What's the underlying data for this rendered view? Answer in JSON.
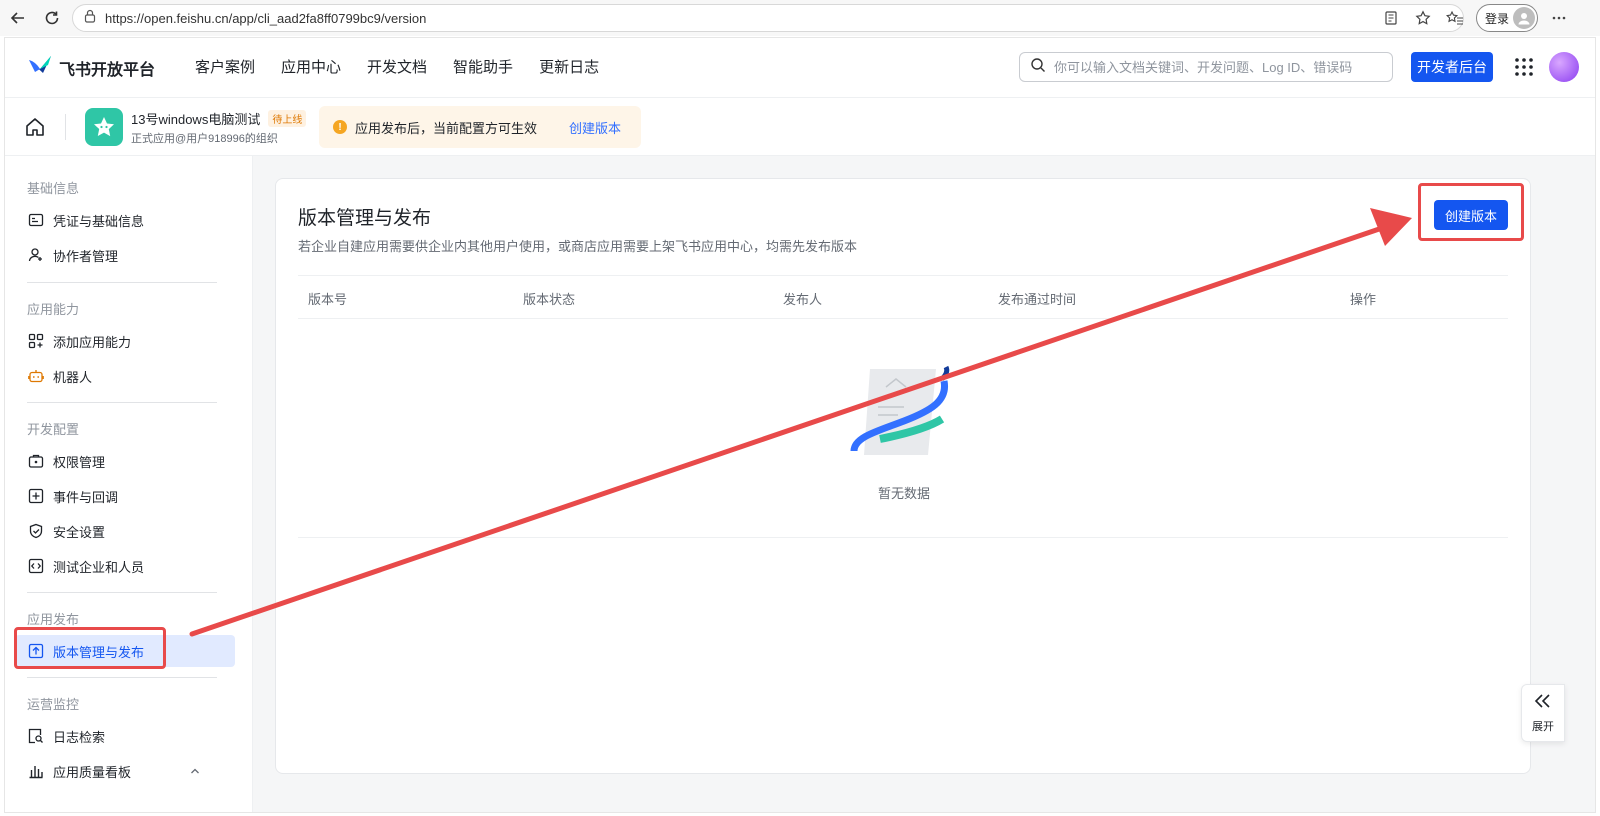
{
  "browser": {
    "url": "https://open.feishu.cn/app/cli_aad2fa8ff0799bc9/version",
    "login_label": "登录"
  },
  "header": {
    "brand": "飞书开放平台",
    "nav": [
      "客户案例",
      "应用中心",
      "开发文档",
      "智能助手",
      "更新日志"
    ],
    "search_placeholder": "你可以输入文档关键词、开发问题、Log ID、错误码",
    "dev_console": "开发者后台"
  },
  "appbar": {
    "app_name": "13号windows电脑测试",
    "status_tag": "待上线",
    "org": "正式应用@用户918996的组织",
    "notice_text": "应用发布后，当前配置方可生效",
    "notice_link": "创建版本"
  },
  "sidebar": {
    "groups": [
      {
        "title": "基础信息",
        "items": [
          "凭证与基础信息",
          "协作者管理"
        ]
      },
      {
        "title": "应用能力",
        "items": [
          "添加应用能力",
          "机器人"
        ]
      },
      {
        "title": "开发配置",
        "items": [
          "权限管理",
          "事件与回调",
          "安全设置",
          "测试企业和人员"
        ]
      },
      {
        "title": "应用发布",
        "items": [
          "版本管理与发布"
        ]
      },
      {
        "title": "运营监控",
        "items": [
          "日志检索",
          "应用质量看板"
        ]
      }
    ]
  },
  "main": {
    "title": "版本管理与发布",
    "description": "若企业自建应用需要供企业内其他用户使用，或商店应用需要上架飞书应用中心，均需先发布版本",
    "create_button": "创建版本",
    "columns": [
      "版本号",
      "版本状态",
      "发布人",
      "发布通过时间",
      "操作"
    ],
    "empty_text": "暂无数据"
  },
  "expand_panel": {
    "label": "展开"
  },
  "colors": {
    "accent": "#1456f0",
    "annotation": "#e84a4a",
    "active_bg": "#e1eaff"
  }
}
